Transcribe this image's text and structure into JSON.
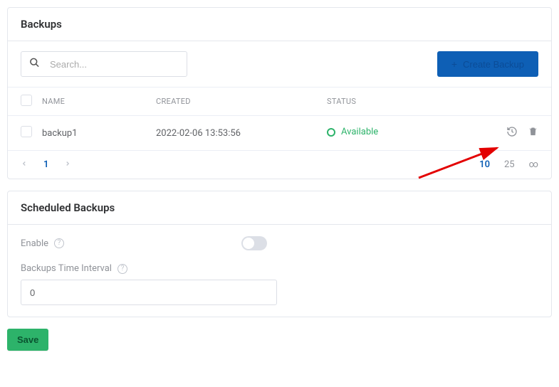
{
  "backups": {
    "title": "Backups",
    "search_placeholder": "Search...",
    "create_button": "Create Backup",
    "columns": {
      "name": "NAME",
      "created": "CREATED",
      "status": "STATUS"
    },
    "rows": [
      {
        "name": "backup1",
        "created": "2022-02-06 13:53:56",
        "status": "Available"
      }
    ],
    "pagination": {
      "current": "1",
      "sizes": {
        "s10": "10",
        "s25": "25",
        "sinf": "∞"
      }
    }
  },
  "scheduled": {
    "title": "Scheduled Backups",
    "enable_label": "Enable",
    "interval_label": "Backups Time Interval",
    "interval_value": "0"
  },
  "save_label": "Save"
}
